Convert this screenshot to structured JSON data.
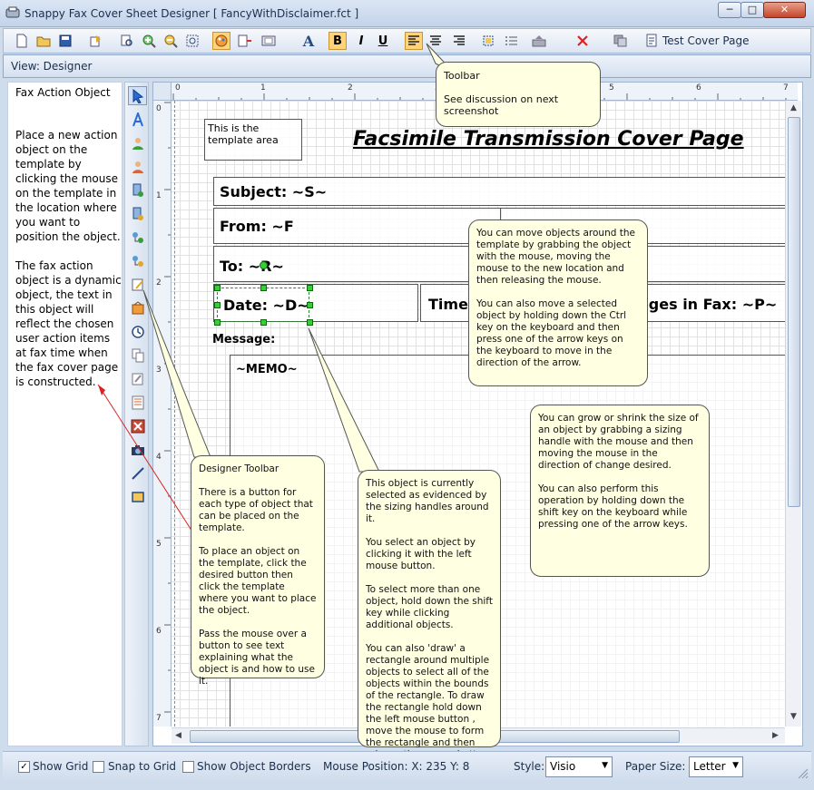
{
  "window": {
    "title": "Snappy Fax Cover Sheet Designer [ FancyWithDisclaimer.fct ]",
    "minimize_glyph": "─",
    "maximize_glyph": "□",
    "close_glyph": "✕"
  },
  "toolbar": {
    "test_cover_page_label": "Test Cover Page",
    "bold_label": "B",
    "italic_label": "I",
    "underline_label": "U",
    "font_label": "A"
  },
  "viewbar": {
    "label": "View: Designer"
  },
  "left_panel": {
    "heading": "Fax Action Object",
    "description": "Place a new action object on the template by clicking the mouse on the template in the location where you want to position the object.\n\nThe fax action object is a dynamic object, the text in this object will reflect the chosen user action items at fax time when the fax cover page is constructed."
  },
  "template": {
    "page_title": "Facsimile Transmission Cover Page",
    "template_note": "This is the template area",
    "subject": "Subject: ~S~",
    "from": "From: ~F",
    "to": "To: ~R~",
    "date": "Date: ~D~",
    "time": "Time",
    "pages": "ages in Fax: ~P~",
    "message_label": "Message:",
    "memo": "~MEMO~"
  },
  "ruler": {
    "top_numbers": [
      "0",
      "1",
      "2",
      "3",
      "4",
      "5",
      "6",
      "7"
    ],
    "left_numbers": [
      "0",
      "1",
      "2",
      "3",
      "4",
      "5",
      "6",
      "7"
    ]
  },
  "callouts": {
    "toolbar": "Toolbar\n\nSee discussion on next screenshot",
    "move": "You can move objects around the template by grabbing the object with the mouse, moving the mouse to the new location and then releasing the mouse.\n\nYou can also move a selected object by holding down the Ctrl key on the keyboard and then press one of the arrow keys on the keyboard to move in the direction of the arrow.",
    "resize": "You can grow or shrink the size of an object by grabbing a sizing handle with the mouse and then moving the mouse in the direction of change desired.\n\nYou can also perform this operation by holding down the shift key on the keyboard while pressing one of the arrow keys.",
    "designer_toolbar": "Designer Toolbar\n\nThere is a button for each type of object that can be placed on the template.\n\nTo place an object on the template, click the desired button then click the template where you want to place the object.\n\nPass the mouse over a button to see text explaining what the object is and how to use it.",
    "selected": "This object is currently selected as evidenced by the sizing handles around it.\n\nYou select an object by clicking it with the left mouse button.\n\nTo select more than one object, hold down the shift key while clicking additional objects.\n\nYou can also 'draw' a rectangle around multiple objects to select all of the objects within the bounds of the rectangle. To draw the rectangle hold down the left mouse button , move the mouse to form the rectangle and then release the mouse button."
  },
  "statusbar": {
    "show_grid_label": "Show Grid",
    "show_grid_checked": true,
    "check_glyph": "✓",
    "snap_to_grid_label": "Snap to Grid",
    "snap_to_grid_checked": false,
    "show_object_borders_label": "Show Object Borders",
    "show_object_borders_checked": false,
    "mouse_position": "Mouse Position: X: 235 Y: 8",
    "style_label": "Style:",
    "style_value": "Visio",
    "paper_size_label": "Paper Size:",
    "paper_size_value": "Letter"
  },
  "colors": {
    "accent": "#ffd37a",
    "callout_bg": "#ffffe1",
    "selection_handle": "#34d034",
    "chrome": "#cfdcec"
  }
}
